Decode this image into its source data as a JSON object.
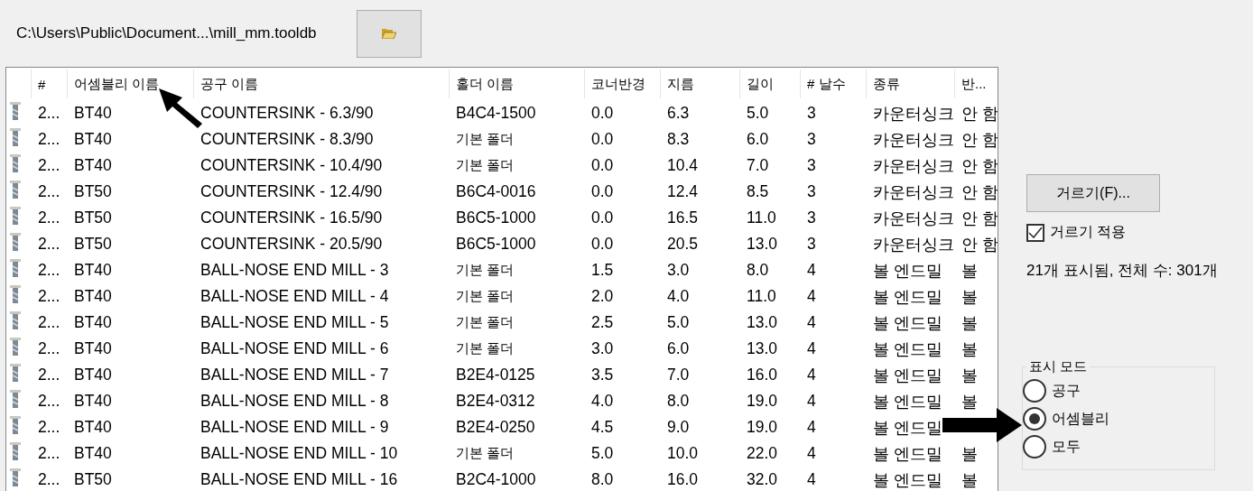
{
  "file_path": "C:\\Users\\Public\\Document...\\mill_mm.tooldb",
  "table": {
    "columns": [
      "#",
      "어셈블리 이름",
      "공구 이름",
      "홀더 이름",
      "코너반경",
      "지름",
      "길이",
      "# 날수",
      "종류",
      "반..."
    ],
    "rows": [
      {
        "cells": [
          "2...",
          "BT40",
          "COUNTERSINK - 6.3/90",
          "B4C4-1500",
          "0.0",
          "6.3",
          "5.0",
          "3",
          "카운터싱크",
          "안 함"
        ]
      },
      {
        "cells": [
          "2...",
          "BT40",
          "COUNTERSINK - 8.3/90",
          "기본 폴더",
          "0.0",
          "8.3",
          "6.0",
          "3",
          "카운터싱크",
          "안 함"
        ]
      },
      {
        "cells": [
          "2...",
          "BT40",
          "COUNTERSINK - 10.4/90",
          "기본 폴더",
          "0.0",
          "10.4",
          "7.0",
          "3",
          "카운터싱크",
          "안 함"
        ]
      },
      {
        "cells": [
          "2...",
          "BT50",
          "COUNTERSINK - 12.4/90",
          "B6C4-0016",
          "0.0",
          "12.4",
          "8.5",
          "3",
          "카운터싱크",
          "안 함"
        ]
      },
      {
        "cells": [
          "2...",
          "BT50",
          "COUNTERSINK - 16.5/90",
          "B6C5-1000",
          "0.0",
          "16.5",
          "11.0",
          "3",
          "카운터싱크",
          "안 함"
        ]
      },
      {
        "cells": [
          "2...",
          "BT50",
          "COUNTERSINK - 20.5/90",
          "B6C5-1000",
          "0.0",
          "20.5",
          "13.0",
          "3",
          "카운터싱크",
          "안 함"
        ]
      },
      {
        "cells": [
          "2...",
          "BT40",
          "BALL-NOSE END MILL - 3",
          "기본 폴더",
          "1.5",
          "3.0",
          "8.0",
          "4",
          "볼 엔드밀",
          "볼"
        ]
      },
      {
        "cells": [
          "2...",
          "BT40",
          "BALL-NOSE END MILL - 4",
          "기본 폴더",
          "2.0",
          "4.0",
          "11.0",
          "4",
          "볼 엔드밀",
          "볼"
        ]
      },
      {
        "cells": [
          "2...",
          "BT40",
          "BALL-NOSE END MILL - 5",
          "기본 폴더",
          "2.5",
          "5.0",
          "13.0",
          "4",
          "볼 엔드밀",
          "볼"
        ]
      },
      {
        "cells": [
          "2...",
          "BT40",
          "BALL-NOSE END MILL - 6",
          "기본 폴더",
          "3.0",
          "6.0",
          "13.0",
          "4",
          "볼 엔드밀",
          "볼"
        ]
      },
      {
        "cells": [
          "2...",
          "BT40",
          "BALL-NOSE END MILL - 7",
          "B2E4-0125",
          "3.5",
          "7.0",
          "16.0",
          "4",
          "볼 엔드밀",
          "볼"
        ]
      },
      {
        "cells": [
          "2...",
          "BT40",
          "BALL-NOSE END MILL - 8",
          "B2E4-0312",
          "4.0",
          "8.0",
          "19.0",
          "4",
          "볼 엔드밀",
          "볼"
        ]
      },
      {
        "cells": [
          "2...",
          "BT40",
          "BALL-NOSE END MILL - 9",
          "B2E4-0250",
          "4.5",
          "9.0",
          "19.0",
          "4",
          "볼 엔드밀"
        ]
      },
      {
        "cells": [
          "2...",
          "BT40",
          "BALL-NOSE END MILL - 10",
          "기본 폴더",
          "5.0",
          "10.0",
          "22.0",
          "4",
          "볼 엔드밀",
          "볼"
        ]
      },
      {
        "cells": [
          "2...",
          "BT50",
          "BALL-NOSE END MILL - 16",
          "B2C4-1000",
          "8.0",
          "16.0",
          "32.0",
          "4",
          "볼 엔드밀",
          "볼"
        ]
      }
    ]
  },
  "filter_button": "거르기(F)...",
  "apply_filter": {
    "label": "거르기 적용",
    "checked": true
  },
  "count_text": "21개 표시됨, 전체 수: 301개",
  "display_mode": {
    "title": "표시 모드",
    "options": [
      {
        "label": "공구",
        "selected": false
      },
      {
        "label": "어셈블리",
        "selected": true
      },
      {
        "label": "모두",
        "selected": false
      }
    ]
  }
}
